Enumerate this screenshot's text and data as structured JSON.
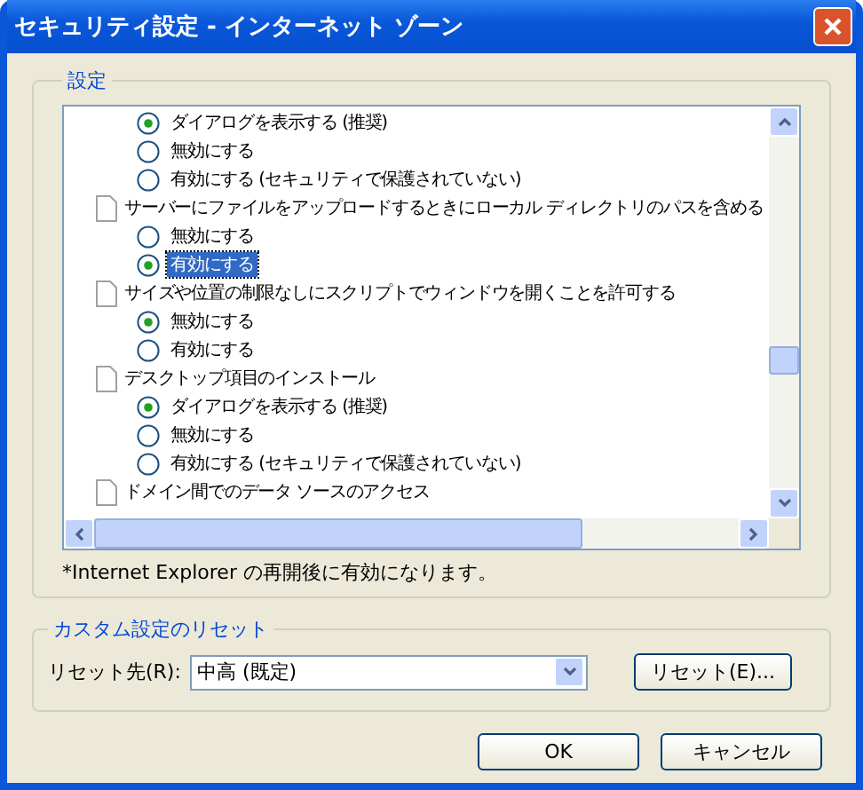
{
  "window": {
    "title": "セキュリティ設定 - インターネット ゾーン"
  },
  "settings": {
    "title": "設定",
    "groups": [
      {
        "options": [
          {
            "label": "ダイアログを表示する (推奨)",
            "selected": true,
            "highlighted": false
          },
          {
            "label": "無効にする",
            "selected": false,
            "highlighted": false
          },
          {
            "label": "有効にする (セキュリティで保護されていない)",
            "selected": false,
            "highlighted": false
          }
        ]
      },
      {
        "label": "サーバーにファイルをアップロードするときにローカル ディレクトリのパスを含める",
        "options": [
          {
            "label": "無効にする",
            "selected": false,
            "highlighted": false
          },
          {
            "label": "有効にする",
            "selected": true,
            "highlighted": true
          }
        ]
      },
      {
        "label": "サイズや位置の制限なしにスクリプトでウィンドウを開くことを許可する",
        "options": [
          {
            "label": "無効にする",
            "selected": true,
            "highlighted": false
          },
          {
            "label": "有効にする",
            "selected": false,
            "highlighted": false
          }
        ]
      },
      {
        "label": "デスクトップ項目のインストール",
        "options": [
          {
            "label": "ダイアログを表示する (推奨)",
            "selected": true,
            "highlighted": false
          },
          {
            "label": "無効にする",
            "selected": false,
            "highlighted": false
          },
          {
            "label": "有効にする (セキュリティで保護されていない)",
            "selected": false,
            "highlighted": false
          }
        ]
      },
      {
        "label": "ドメイン間でのデータ ソースのアクセス"
      }
    ],
    "note": "*Internet Explorer の再開後に有効になります。"
  },
  "reset": {
    "title": "カスタム設定のリセット",
    "label": "リセット先(R):",
    "value": "中高 (既定)",
    "button": "リセット(E)..."
  },
  "buttons": [
    "OK",
    "キャンセル"
  ]
}
